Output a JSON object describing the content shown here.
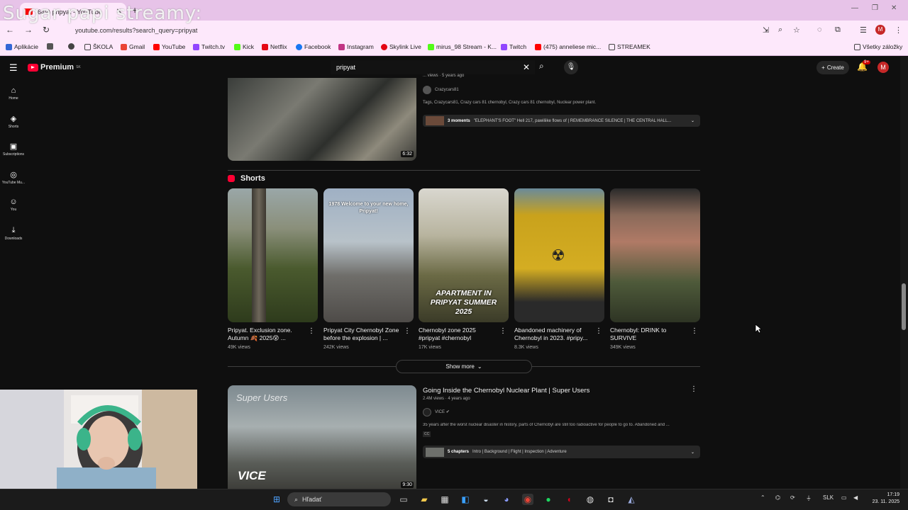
{
  "browser": {
    "tab_title": "(649) pripyat - YouTube",
    "new_tab": "+",
    "url": "youtube.com/results?search_query=pripyat",
    "avatar": "M",
    "overlay_text": "Sugar papi streamy:",
    "bookmarks": [
      {
        "label": "Aplikácie",
        "color": "#3367d6"
      },
      {
        "label": "ŠKOLA",
        "color": "#666"
      },
      {
        "label": "Gmail",
        "color": "#ea4335"
      },
      {
        "label": "YouTube",
        "color": "#ff0000"
      },
      {
        "label": "Twitch.tv",
        "color": "#9146ff"
      },
      {
        "label": "Kick",
        "color": "#53fc18"
      },
      {
        "label": "Netflix",
        "color": "#e50914"
      },
      {
        "label": "Facebook",
        "color": "#1877f2"
      },
      {
        "label": "Instagram",
        "color": "#c13584"
      },
      {
        "label": "Skylink Live",
        "color": "#e30613"
      },
      {
        "label": "mirus_98 Stream - K...",
        "color": "#53fc18"
      },
      {
        "label": "Twitch",
        "color": "#9146ff"
      },
      {
        "label": "(475) anneliese mic...",
        "color": "#ff0000"
      },
      {
        "label": "STREAMEK",
        "color": "#666"
      },
      {
        "label": "Všetky záložky",
        "color": "#666"
      }
    ]
  },
  "youtube": {
    "logo": "Premium",
    "logo_sup": "SK",
    "search_value": "pripyat",
    "create_label": "Create",
    "bell_badge": "9+",
    "avatar": "M",
    "guide": [
      {
        "icon": "⌂",
        "label": "Home"
      },
      {
        "icon": "◈",
        "label": "Shorts"
      },
      {
        "icon": "▣",
        "label": "Subscriptions"
      },
      {
        "icon": "◎",
        "label": "YouTube Mu..."
      },
      {
        "icon": "☺",
        "label": "You"
      },
      {
        "icon": "⤓",
        "label": "Downloads"
      }
    ],
    "top_video": {
      "duration": "6:32",
      "meta": "... views · 5 years ago",
      "channel": "Crazycars81",
      "tags": "Tags, Crazycars81, Crazy cars 81 chernobyl, Crazy cars 81 chernobyl, Nuclear power plant.",
      "moments_count": "3 moments",
      "moments_text": "\"ELEPHANT'S FOOT\" Hell 217, pawiliike flows of | REMEMBRANCE SILENCE | THE CENTRAL HALL..."
    },
    "shorts_heading": "Shorts",
    "shorts": [
      {
        "title": "Pripyat. Exclusion zone. Autumn 🍂 2025😵 ...",
        "views": "49K views",
        "overlay": ""
      },
      {
        "title": "Pripyat City Chernobyl Zone before the explosion | ...",
        "views": "242K views",
        "overlay": "1978 Welcome to your new home, Pripyat!"
      },
      {
        "title": "Chernobyl zone 2025 #pripyat #chernobyl",
        "views": "17K views",
        "overlay": "APARTMENT IN PRIPYAT SUMMER 2025"
      },
      {
        "title": "Abandoned machinery of Chernobyl in 2023. #pripy...",
        "views": "8.3K views",
        "overlay": ""
      },
      {
        "title": "Chernobyl: DRINK to SURVIVE",
        "views": "349K views",
        "overlay": ""
      }
    ],
    "show_more": "Show more",
    "video2": {
      "title": "Going Inside the Chernobyl Nuclear Plant | Super Users",
      "meta": "2.4M views · 4 years ago",
      "channel": "VICE",
      "desc": "35 years after the worst nuclear disaster in history, parts of Chernobyl are still too radioactive for people to go to. Abandoned and ...",
      "cc": "CC",
      "chapters_count": "5 chapters",
      "chapters_text": "Intro | Background | Flight | Inspection | Adventure",
      "duration": "9:30",
      "thumb_title": "Super Users",
      "thumb_logo": "VICE"
    }
  },
  "taskbar": {
    "search": "Hľadať",
    "lang": "SLK",
    "time": "17:19",
    "date": "23. 11. 2025"
  }
}
